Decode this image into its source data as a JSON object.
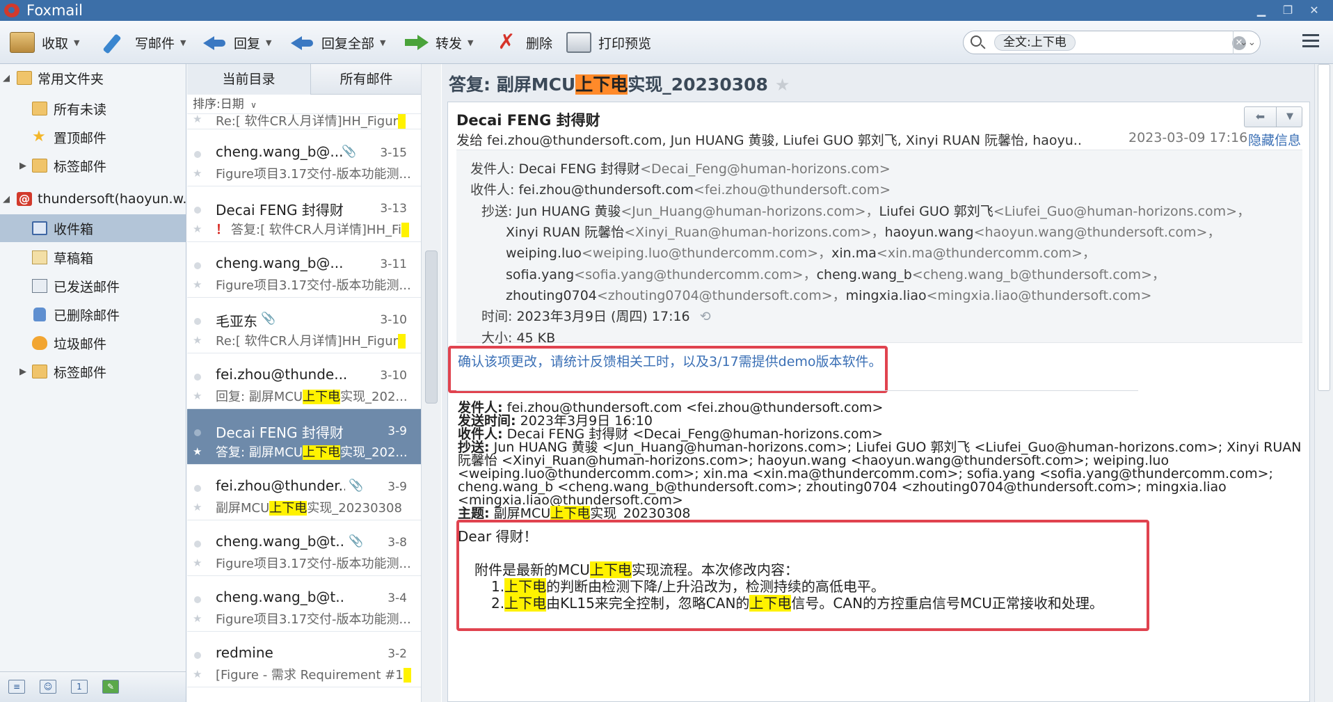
{
  "app": {
    "title": "Foxmail"
  },
  "toolbar": {
    "receive": "收取",
    "compose": "写邮件",
    "reply": "回复",
    "reply_all": "回复全部",
    "forward": "转发",
    "delete": "删除",
    "print_preview": "打印预览"
  },
  "search": {
    "chip": "全文:上下电"
  },
  "folders": {
    "favorites": "常用文件夹",
    "all_unread": "所有未读",
    "pinned": "置顶邮件",
    "tagged": "标签邮件",
    "account": "thundersoft(haoyun.w...",
    "inbox": "收件箱",
    "drafts": "草稿箱",
    "sent": "已发送邮件",
    "deleted": "已删除邮件",
    "junk": "垃圾邮件",
    "tagged2": "标签邮件"
  },
  "list": {
    "tab_current": "当前目录",
    "tab_all": "所有邮件",
    "sort": "排序:日期",
    "partial_subject": "Re:[ 软件CR人月详情]HH_Figur",
    "items": [
      {
        "sender": "cheng.wang_b@...",
        "date": "3-15",
        "subject": "Figure项目3.17交付-版本功能测..."
      },
      {
        "sender": "Decai FENG 封得财",
        "date": "3-13",
        "flag": "！",
        "subject": "答复:[ 软件CR人月详情]HH_Fi"
      },
      {
        "sender": "cheng.wang_b@...",
        "date": "3-11",
        "subject": "Figure项目3.17交付-版本功能测..."
      },
      {
        "sender": "毛亚东",
        "date": "3-10",
        "subject": "Re:[ 软件CR人月详情]HH_Figur"
      },
      {
        "sender": "fei.zhou@thunde...",
        "date": "3-10",
        "subject_pre": "回复: 副屏MCU",
        "subject_hl": "上下电",
        "subject_post": "实现_202..."
      },
      {
        "sender": "Decai FENG 封得财",
        "date": "3-9",
        "subject_pre": "答复: 副屏MCU",
        "subject_hl": "上下电",
        "subject_post": "实现_202..."
      },
      {
        "sender": "fei.zhou@thunder...",
        "date": "3-9",
        "subject_pre": "副屏MCU",
        "subject_hl": "上下电",
        "subject_post": "实现_20230308"
      },
      {
        "sender": "cheng.wang_b@t...",
        "date": "3-8",
        "subject": "Figure项目3.17交付-版本功能测..."
      },
      {
        "sender": "cheng.wang_b@t...",
        "date": "3-4",
        "subject": "Figure项目3.17交付-版本功能测..."
      },
      {
        "sender": "redmine",
        "date": "3-2",
        "subject": "[Figure - 需求 Requirement #1"
      }
    ]
  },
  "mail": {
    "subject_pre": "答复: 副屏MCU",
    "subject_hl": "上下电",
    "subject_post": "实现_20230308",
    "from_name": "Decai FENG 封得财",
    "to_line": "发给 fei.zhou@thundersoft.com, Jun HUANG 黄骏, Liufei GUO 郭刘飞, Xinyi RUAN 阮馨怡, haoyu...",
    "sent_time": "2023-03-09 17:16",
    "hide_info": "隐藏信息",
    "detail": {
      "from_label": "发件人:",
      "from_name": "Decai FENG 封得财",
      "from_addr": "<Decai_Feng@human-horizons.com>",
      "to_label": "收件人:",
      "to_name": "fei.zhou@thundersoft.com",
      "to_addr": "<fei.zhou@thundersoft.com>",
      "cc_label": "抄送:",
      "cc1": "Jun HUANG 黄骏",
      "cc1_addr": "<Jun_Huang@human-horizons.com>，",
      "cc2": "Liufei GUO 郭刘飞",
      "cc2_addr": "<Liufei_Guo@human-horizons.com>，",
      "cc3": "Xinyi RUAN 阮馨怡",
      "cc3_addr": "<Xinyi_Ruan@human-horizons.com>，",
      "cc4": "haoyun.wang",
      "cc4_addr": "<haoyun.wang@thundersoft.com>，",
      "cc5": "weiping.luo",
      "cc5_addr": "<weiping.luo@thundercomm.com>，",
      "cc6": "xin.ma",
      "cc6_addr": "<xin.ma@thundercomm.com>，",
      "cc7": "sofia.yang",
      "cc7_addr": "<sofia.yang@thundercomm.com>，",
      "cc8": "cheng.wang_b",
      "cc8_addr": "<cheng.wang_b@thundersoft.com>，",
      "cc9": "zhouting0704",
      "cc9_addr": "<zhouting0704@thundersoft.com>，",
      "cc10": "mingxia.liao",
      "cc10_addr": "<mingxia.liao@thundersoft.com>",
      "time_label": "时间:",
      "time_value": "2023年3月9日 (周四) 17:16",
      "size_label": "大小:",
      "size_value": "45 KB"
    },
    "note": "确认该项更改，请统计反馈相关工时，以及3/17需提供demo版本软件。",
    "quoted": {
      "from_label": "发件人:",
      "from_value": "fei.zhou@thundersoft.com <fei.zhou@thundersoft.com>",
      "sent_label": "发送时间:",
      "sent_value": "2023年3月9日 16:10",
      "to_label": "收件人:",
      "to_value": "Decai FENG 封得财 <Decai_Feng@human-horizons.com>",
      "cc_label": "抄送:",
      "cc_value": "Jun HUANG 黄骏 <Jun_Huang@human-horizons.com>; Liufei GUO 郭刘飞 <Liufei_Guo@human-horizons.com>; Xinyi RUAN 阮馨怡 <Xinyi_Ruan@human-horizons.com>; haoyun.wang <haoyun.wang@thundersoft.com>; weiping.luo <weiping.luo@thundercomm.com>; xin.ma <xin.ma@thundercomm.com>; sofia.yang <sofia.yang@thundercomm.com>; cheng.wang_b <cheng.wang_b@thundersoft.com>; zhouting0704 <zhouting0704@thundersoft.com>; mingxia.liao <mingxia.liao@thundersoft.com>",
      "subj_label": "主题:",
      "subj_pre": "副屏MCU",
      "subj_hl": "上下电",
      "subj_post": "实现_20230308"
    },
    "body": {
      "greeting": "Dear 得财！",
      "intro_pre": "附件是最新的MCU",
      "intro_hl": "上下电",
      "intro_post": "实现流程。本次修改内容：",
      "item1_num": "1.",
      "item1_hl": "上下电",
      "item1_post": "的判断由检测下降/上升沿改为，检测持续的高低电平。",
      "item2_num": "2.",
      "item2_hl": "上下电",
      "item2_mid": "由KL15来完全控制，忽略CAN的",
      "item2_hl2": "上下电",
      "item2_post": "信号。CAN的方控重启信号MCU正常接收和处理。"
    }
  },
  "colors": {
    "title_bar": "#3c6fa8",
    "highlight": "#fff200",
    "subject_highlight": "#ff8a2a",
    "annotation_box": "#e0434f",
    "link": "#3a6fb5"
  }
}
